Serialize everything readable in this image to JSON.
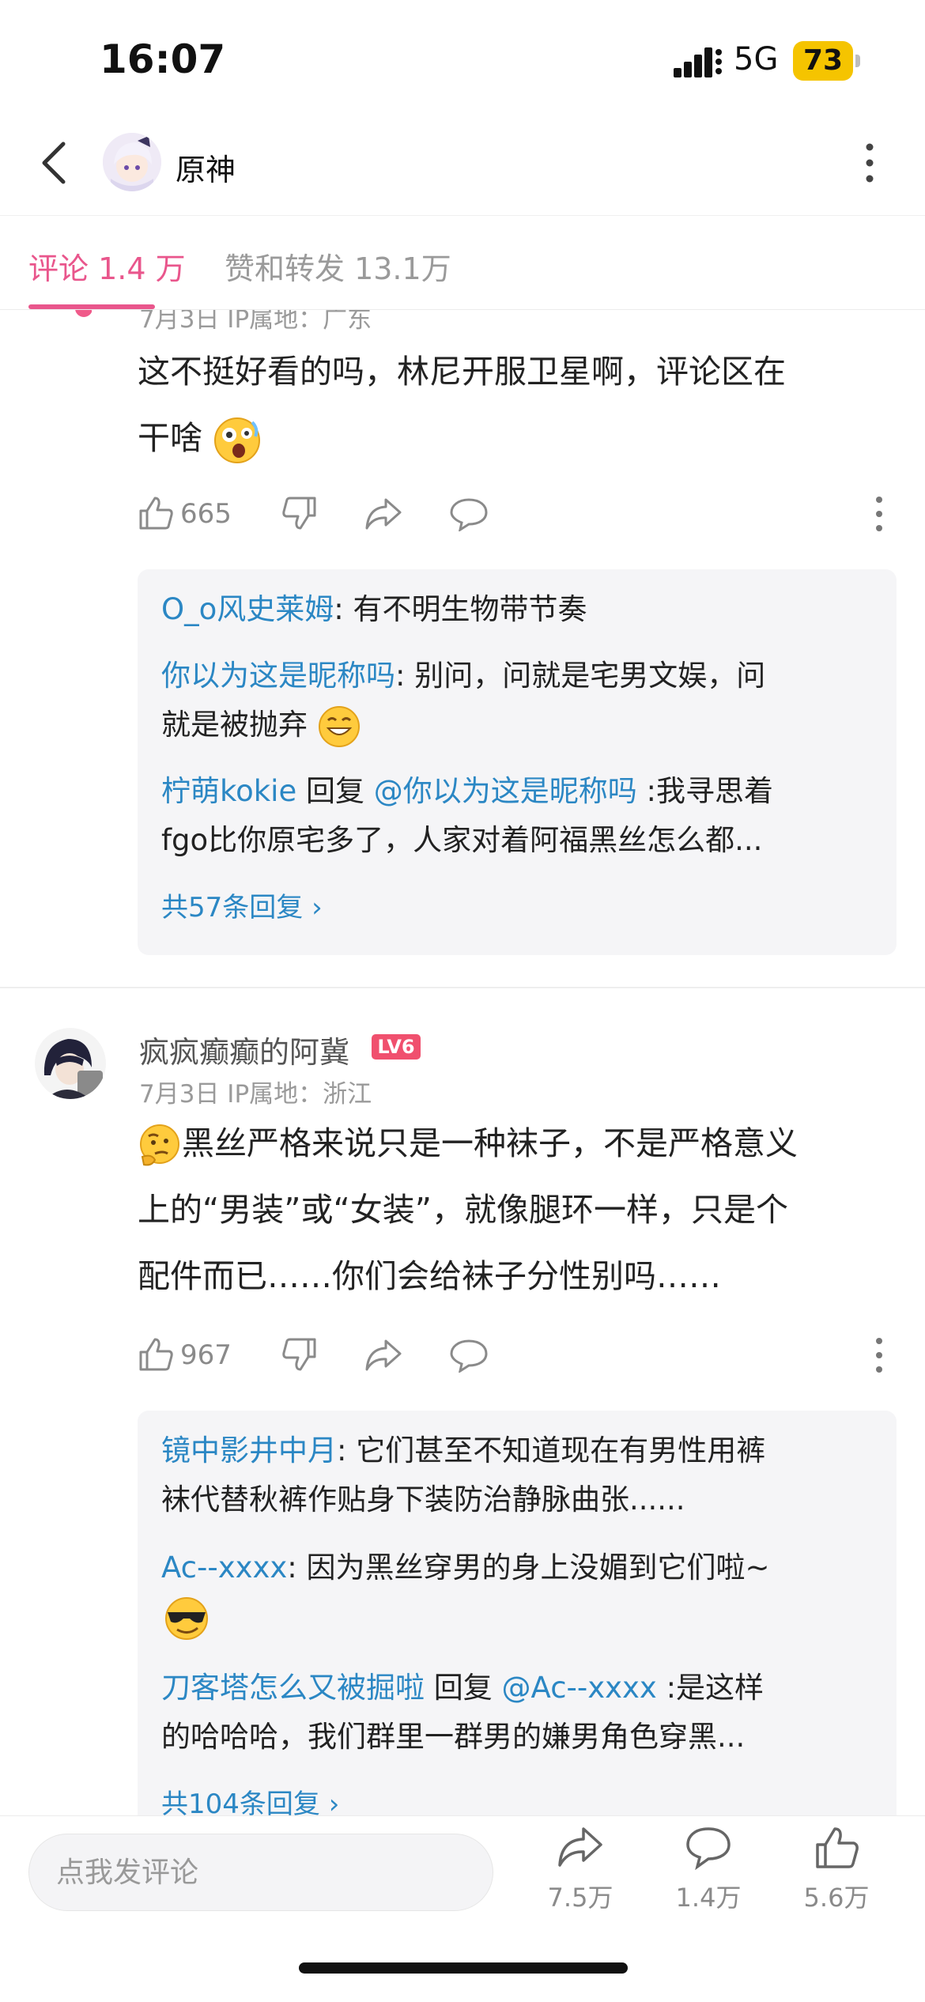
{
  "status": {
    "time": "16:07",
    "network": "5G",
    "battery": "73"
  },
  "nav": {
    "title": "原神"
  },
  "tabs": {
    "comments": "评论 1.4 万",
    "likes": "赞和转发 13.1万"
  },
  "comment1": {
    "meta": "7月3日 IP属地：广东",
    "text_line1": "这不挺好看的吗，林尼开服卫星啊，评论区在",
    "text_line2": "干啥",
    "likes": "665",
    "replies": [
      {
        "user": "O_o风史莱姆",
        "sep": ": ",
        "text": "有不明生物带节奏"
      },
      {
        "user": "你以为这是昵称吗",
        "sep": ": ",
        "text": "别问，问就是宅男文娱，问",
        "text2": "就是被抛弃"
      },
      {
        "user": "柠萌kokie",
        "reply_word": " 回复 ",
        "target": "@你以为这是昵称吗",
        "text": " :我寻思着",
        "text2": "fgo比你原宅多了，人家对着阿福黑丝怎么都..."
      }
    ],
    "more": "共57条回复 ›"
  },
  "comment2": {
    "user": "疯疯癫癫的阿冀",
    "level": "LV6",
    "meta": "7月3日 IP属地：浙江",
    "text_line1": "黑丝严格来说只是一种袜子，不是严格意义",
    "text_line2": "上的“男装”或“女装”，就像腿环一样，只是个",
    "text_line3": "配件而已……你们会给袜子分性别吗……",
    "likes": "967",
    "replies": [
      {
        "user": "镜中影井中月",
        "sep": ": ",
        "text": "它们甚至不知道现在有男性用裤",
        "text2": "袜代替秋裤作贴身下装防治静脉曲张......"
      },
      {
        "user": "Ac--xxxx",
        "sep": ": ",
        "text": "因为黑丝穿男的身上没媚到它们啦~"
      },
      {
        "user": "刀客塔怎么又被掘啦",
        "reply_word": " 回复 ",
        "target": "@Ac--xxxx",
        "text": " :是这样",
        "text2": "的哈哈哈，我们群里一群男的嫌男角色穿黑..."
      }
    ],
    "more": "共104条回复 ›"
  },
  "bottom": {
    "input_placeholder": "点我发评论",
    "forward": "7.5万",
    "comments": "1.4万",
    "likes": "5.6万"
  },
  "colors": {
    "accent": "#e9568c",
    "link": "#2b87c4",
    "battery": "#f5c400",
    "level_badge": "#f0506e"
  }
}
